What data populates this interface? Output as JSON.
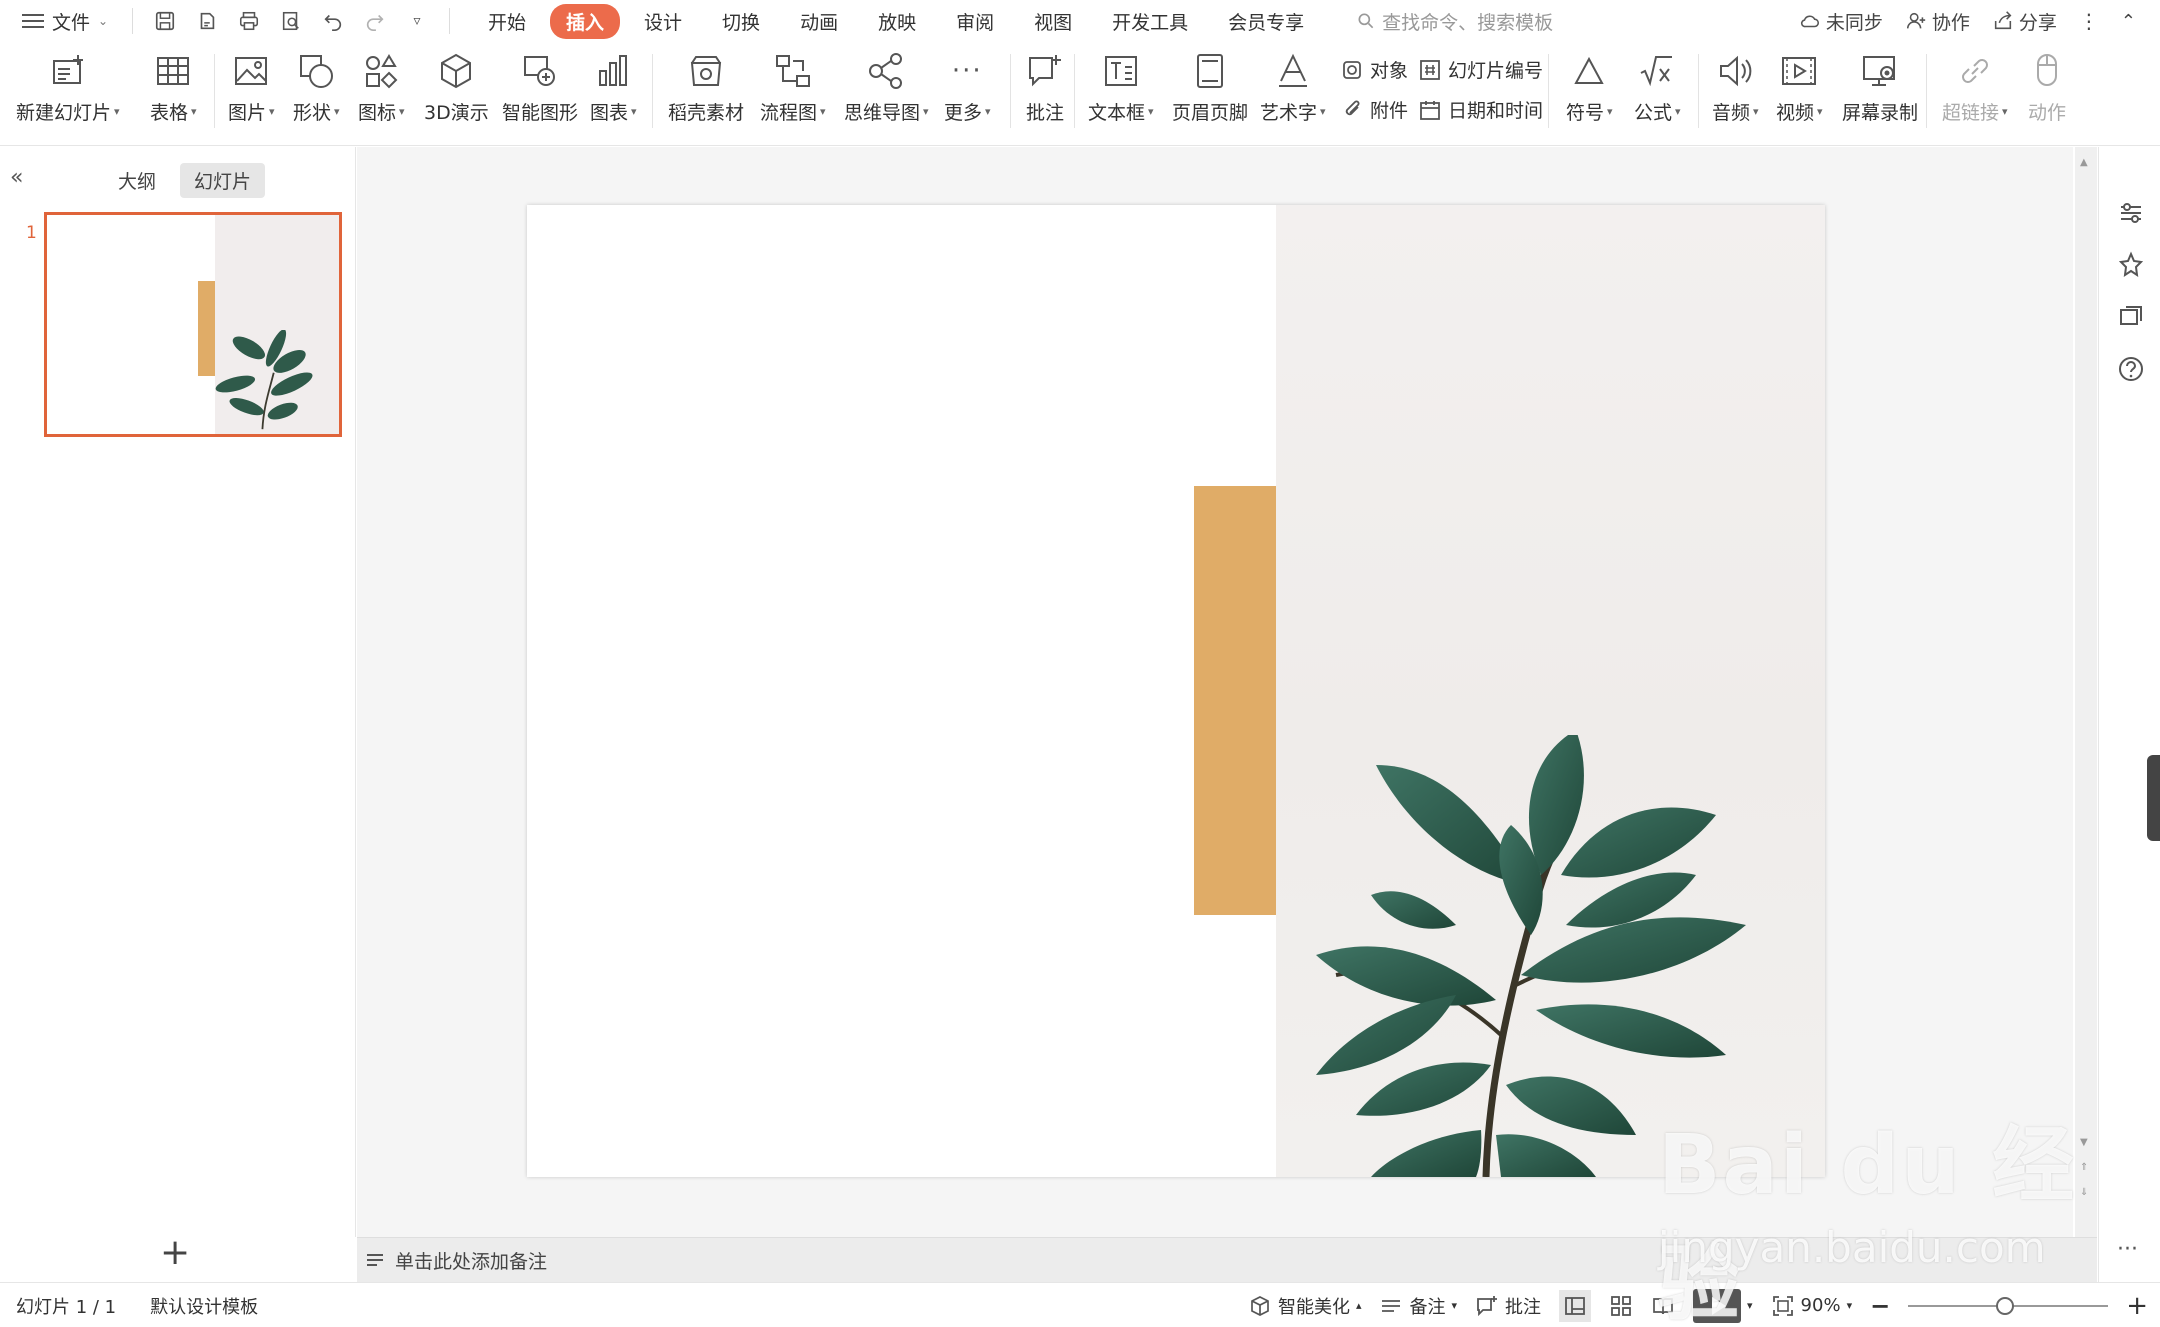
{
  "menubar": {
    "file_label": "文件",
    "tabs": [
      "开始",
      "插入",
      "设计",
      "切换",
      "动画",
      "放映",
      "审阅",
      "视图",
      "开发工具",
      "会员专享"
    ],
    "active_tab": "插入",
    "search_placeholder": "查找命令、搜索模板",
    "sync_label": "未同步",
    "collab_label": "协作",
    "share_label": "分享"
  },
  "ribbon": {
    "new_slide": "新建幻灯片",
    "table": "表格",
    "picture": "图片",
    "shape": "形状",
    "icon": "图标",
    "demo3d": "3D演示",
    "smartart": "智能图形",
    "chart": "图表",
    "material": "稻壳素材",
    "flowchart": "流程图",
    "mindmap": "思维导图",
    "more": "更多",
    "comment": "批注",
    "textbox": "文本框",
    "header_footer": "页眉页脚",
    "wordart": "艺术字",
    "object": "对象",
    "slide_number": "幻灯片编号",
    "attachment": "附件",
    "datetime": "日期和时间",
    "symbol": "符号",
    "formula": "公式",
    "audio": "音频",
    "video": "视频",
    "screen_record": "屏幕录制",
    "hyperlink": "超链接",
    "action": "动作"
  },
  "leftpanel": {
    "tab_outline": "大纲",
    "tab_slides": "幻灯片",
    "slide_number": "1"
  },
  "slide": {
    "accent_color": "#e0ac67",
    "right_bg_color": "#f1eded"
  },
  "notes": {
    "placeholder": "单击此处添加备注"
  },
  "statusbar": {
    "slide_info": "幻灯片 1 / 1",
    "template": "默认设计模板",
    "smart_beautify": "智能美化",
    "notes": "备注",
    "comments": "批注",
    "zoom": "90%"
  },
  "watermark": {
    "brand": "Bai du 经验",
    "url": "jingyan.baidu.com"
  }
}
